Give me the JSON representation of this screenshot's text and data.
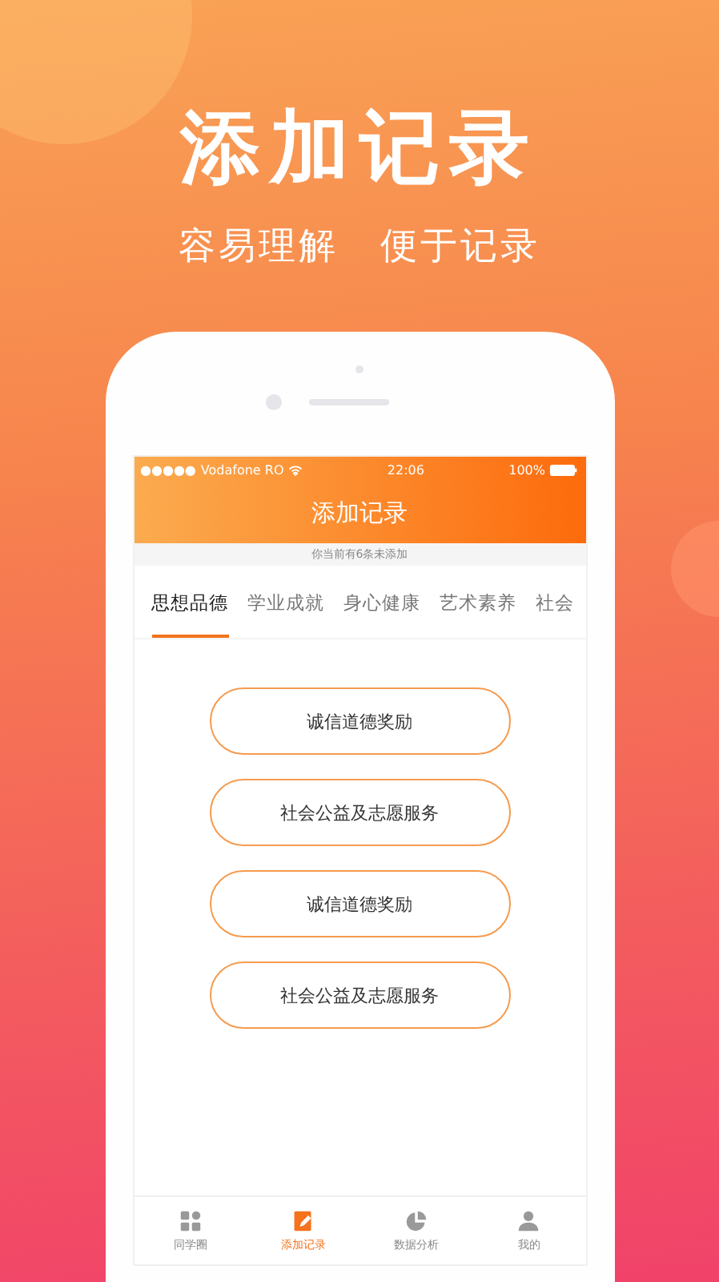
{
  "headline": "添加记录",
  "taglines": [
    "容易理解",
    "便于记录"
  ],
  "status_bar": {
    "signal": "●●●●●",
    "carrier": "Vodafone RO",
    "time": "22:06",
    "battery": "100%"
  },
  "nav_title": "添加记录",
  "notice": "你当前有6条未添加",
  "tabs": [
    {
      "label": "思想品德",
      "selected": true
    },
    {
      "label": "学业成就",
      "selected": false
    },
    {
      "label": "身心健康",
      "selected": false
    },
    {
      "label": "艺术素养",
      "selected": false
    },
    {
      "label": "社会",
      "selected": false
    }
  ],
  "options": [
    "诚信道德奖励",
    "社会公益及志愿服务",
    "诚信道德奖励",
    "社会公益及志愿服务"
  ],
  "bottom_nav": [
    {
      "kind": "grid",
      "label": "同学圈",
      "selected": false
    },
    {
      "kind": "notebook",
      "label": "添加记录",
      "selected": true
    },
    {
      "kind": "pie",
      "label": "数据分析",
      "selected": false
    },
    {
      "kind": "person",
      "label": "我的",
      "selected": false
    }
  ]
}
